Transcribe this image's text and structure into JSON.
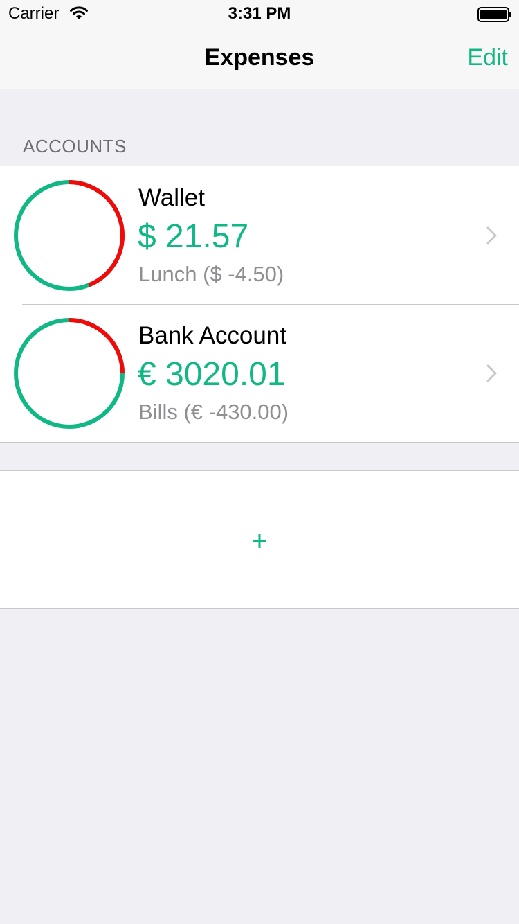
{
  "status_bar": {
    "carrier": "Carrier",
    "time": "3:31 PM"
  },
  "nav": {
    "title": "Expenses",
    "edit_label": "Edit"
  },
  "accounts_section": {
    "header": "ACCOUNTS",
    "accounts": [
      {
        "name": "Wallet",
        "balance": "$ 21.57",
        "last_transaction": "Lunch ($ -4.50)",
        "spent_fraction": 0.44
      },
      {
        "name": "Bank Account",
        "balance": "€ 3020.01",
        "last_transaction": "Bills (€ -430.00)",
        "spent_fraction": 0.25
      }
    ]
  },
  "add_button": {
    "icon": "plus-icon"
  },
  "colors": {
    "accent": "#11b886",
    "spent": "#f00a0a",
    "secondary_text": "#8e8e93",
    "chevron": "#c7c7cc"
  }
}
